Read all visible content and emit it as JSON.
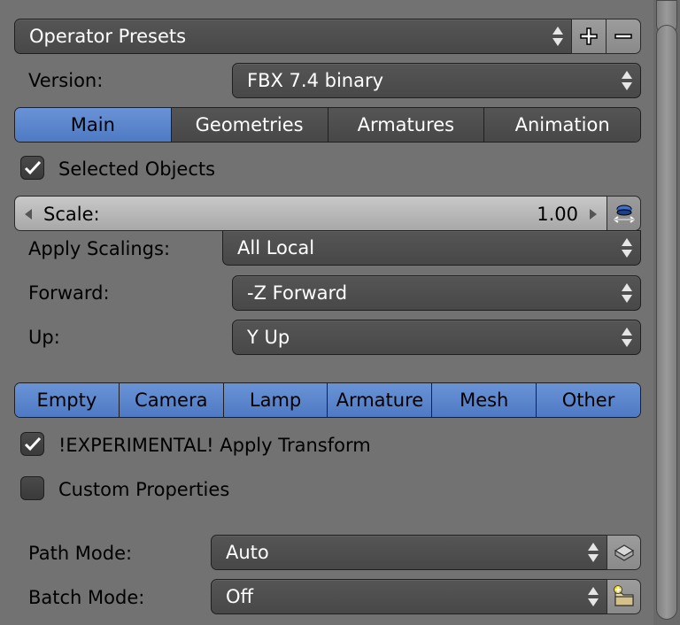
{
  "presets": {
    "label": "Operator Presets"
  },
  "version": {
    "label": "Version:",
    "value": "FBX 7.4 binary"
  },
  "main_tabs": [
    {
      "label": "Main",
      "active": true
    },
    {
      "label": "Geometries",
      "active": false
    },
    {
      "label": "Armatures",
      "active": false
    },
    {
      "label": "Animation",
      "active": false
    }
  ],
  "selected_objects": {
    "label": "Selected Objects",
    "checked": true
  },
  "scale": {
    "label": "Scale:",
    "value": "1.00"
  },
  "apply_scalings": {
    "label": "Apply Scalings:",
    "value": "All Local"
  },
  "forward": {
    "label": "Forward:",
    "value": "-Z Forward"
  },
  "up": {
    "label": "Up:",
    "value": "Y Up"
  },
  "object_types": [
    {
      "label": "Empty",
      "selected": true
    },
    {
      "label": "Camera",
      "selected": true
    },
    {
      "label": "Lamp",
      "selected": true
    },
    {
      "label": "Armature",
      "selected": true
    },
    {
      "label": "Mesh",
      "selected": true
    },
    {
      "label": "Other",
      "selected": true
    }
  ],
  "apply_transform": {
    "label": "!EXPERIMENTAL! Apply Transform",
    "checked": true
  },
  "custom_properties": {
    "label": "Custom Properties",
    "checked": false
  },
  "path_mode": {
    "label": "Path Mode:",
    "value": "Auto"
  },
  "batch_mode": {
    "label": "Batch Mode:",
    "value": "Off"
  },
  "colors": {
    "panel_bg": "#727272",
    "accent": "#5b86cc",
    "field_bg": "#4f4f4f"
  }
}
